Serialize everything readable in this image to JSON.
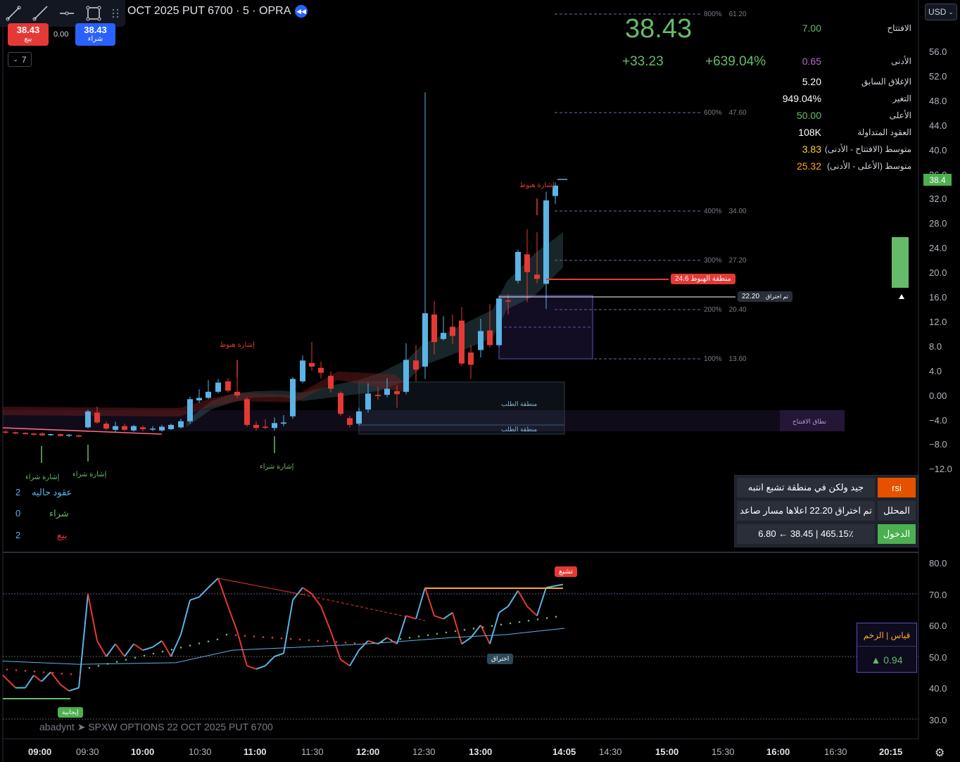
{
  "toolbar": {
    "tools": [
      "trend-line-icon",
      "ray-icon",
      "horizontal-line-icon",
      "rectangle-icon"
    ]
  },
  "header": {
    "title": "OCT 2025 PUT 6700 · 5 · OPRA",
    "currency": "USD"
  },
  "order": {
    "sell_price": "38.43",
    "sell_label": "بيع",
    "buy_price": "38.43",
    "buy_label": "شراء",
    "spread": "0.00",
    "lot": "7"
  },
  "quote": {
    "last": "38.43",
    "change": "+33.23",
    "change_pct": "+639.04%",
    "rows": [
      {
        "label": "الافتتاح",
        "value": "7.00",
        "color": "#66bb6a"
      },
      {
        "label": "الأدنى",
        "value": "0.65",
        "color": "#ba68c8"
      },
      {
        "label": "الإغلاق السابق",
        "value": "5.20",
        "color": "#ffffff"
      },
      {
        "label": "التغير",
        "value": "949.04%",
        "color": "#ffffff"
      },
      {
        "label": "الأعلى",
        "value": "50.00",
        "color": "#66bb6a"
      },
      {
        "label": "العقود المتداولة",
        "value": "108K",
        "color": "#ffffff"
      },
      {
        "label": "متوسط (الافتتاح - الأدنى)",
        "value": "3.83",
        "color": "#fdd835"
      },
      {
        "label": "متوسط (الأعلى - الأدنى)",
        "value": "25.32",
        "color": "#ffa726"
      }
    ]
  },
  "price_axis": {
    "labels": [
      "56.0",
      "52.0",
      "48.0",
      "44.0",
      "40.0",
      "36.0",
      "32.0",
      "28.0",
      "24.0",
      "20.0",
      "16.0",
      "12.0",
      "8.0",
      "4.0",
      "0.00",
      "−4.0",
      "−8.0",
      "−12.0"
    ],
    "last_tag": "38.4"
  },
  "rsi_axis": {
    "labels": [
      "80.0",
      "70.0",
      "60.0",
      "50.0",
      "40.0",
      "30.0"
    ]
  },
  "time_axis": [
    {
      "label": "09:00",
      "bold": true
    },
    {
      "label": "09:30",
      "bold": false
    },
    {
      "label": "10:00",
      "bold": true
    },
    {
      "label": "10:30",
      "bold": false
    },
    {
      "label": "11:00",
      "bold": true
    },
    {
      "label": "11:30",
      "bold": false
    },
    {
      "label": "12:00",
      "bold": true
    },
    {
      "label": "12:30",
      "bold": false
    },
    {
      "label": "13:00",
      "bold": true
    },
    {
      "label": "14:05",
      "bold": true
    },
    {
      "label": "14:30",
      "bold": false
    },
    {
      "label": "15:00",
      "bold": true
    },
    {
      "label": "15:30",
      "bold": false
    },
    {
      "label": "16:00",
      "bold": true
    },
    {
      "label": "16:30",
      "bold": false
    },
    {
      "label": "20:15",
      "bold": true
    }
  ],
  "fib_levels": [
    {
      "pct": "800%",
      "value": "61.20"
    },
    {
      "pct": "600%",
      "value": "47.60"
    },
    {
      "pct": "400%",
      "value": "34.00"
    },
    {
      "pct": "300%",
      "value": "27.20"
    },
    {
      "pct": "200%",
      "value": "20.40"
    },
    {
      "pct": "100%",
      "value": "13.60"
    }
  ],
  "annotations": {
    "sell_signal": "إشارة هبوط",
    "buy_signal": "إشارة شراء",
    "demand_zone": "منطقة الطلب",
    "opening_range": "نطاق الافتتاح",
    "bear_zone_tag": "منطقة الهبوط 24.6",
    "breakout_tag_label": "تم اختراق",
    "breakout_tag_value": "22.20",
    "overbought": "تشبع",
    "breakout": "اختراق",
    "positive": "إيجابية"
  },
  "positions": {
    "open_label": "عقود حاليه",
    "open_value": "2",
    "buy_label": "شراء",
    "buy_value": "0",
    "sell_label": "بيع",
    "sell_value": "2"
  },
  "analysis_table": {
    "rsi_label": "rsi",
    "rsi_text": "جيد ولكن في منطقة تشبع انتبه",
    "analyst_label": "المحلل",
    "analyst_text": "تم اختراق 22.20 اعلاها مسار صاعد",
    "entry_label": "الدخول",
    "entry_text": "6.80 ← 38.45 | 465.15٪"
  },
  "momentum": {
    "label": "قياس | الزخم",
    "value": "▲ 0.94"
  },
  "footer": {
    "text": "abadynt ➤  SPXW OPTIONS 22 OCT 2025 PUT 6700"
  },
  "colors": {
    "up": "#5bb4e5",
    "down": "#e53935",
    "green": "#66bb6a",
    "accent": "#2962ff"
  }
}
